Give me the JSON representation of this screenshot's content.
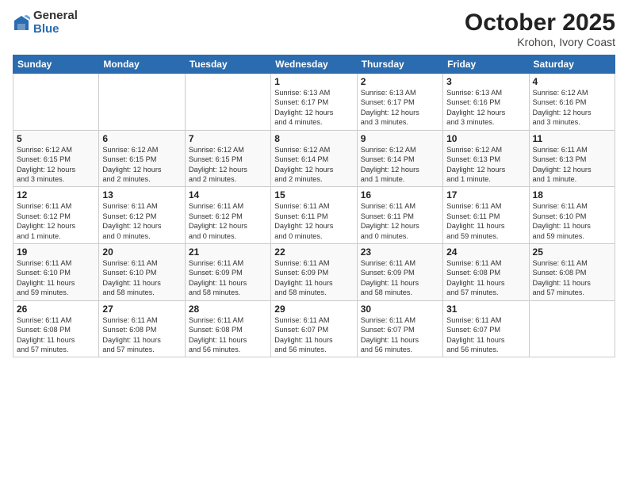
{
  "logo": {
    "general": "General",
    "blue": "Blue"
  },
  "header": {
    "month": "October 2025",
    "location": "Krohon, Ivory Coast"
  },
  "weekdays": [
    "Sunday",
    "Monday",
    "Tuesday",
    "Wednesday",
    "Thursday",
    "Friday",
    "Saturday"
  ],
  "weeks": [
    [
      {
        "day": "",
        "info": ""
      },
      {
        "day": "",
        "info": ""
      },
      {
        "day": "",
        "info": ""
      },
      {
        "day": "1",
        "info": "Sunrise: 6:13 AM\nSunset: 6:17 PM\nDaylight: 12 hours\nand 4 minutes."
      },
      {
        "day": "2",
        "info": "Sunrise: 6:13 AM\nSunset: 6:17 PM\nDaylight: 12 hours\nand 3 minutes."
      },
      {
        "day": "3",
        "info": "Sunrise: 6:13 AM\nSunset: 6:16 PM\nDaylight: 12 hours\nand 3 minutes."
      },
      {
        "day": "4",
        "info": "Sunrise: 6:12 AM\nSunset: 6:16 PM\nDaylight: 12 hours\nand 3 minutes."
      }
    ],
    [
      {
        "day": "5",
        "info": "Sunrise: 6:12 AM\nSunset: 6:15 PM\nDaylight: 12 hours\nand 3 minutes."
      },
      {
        "day": "6",
        "info": "Sunrise: 6:12 AM\nSunset: 6:15 PM\nDaylight: 12 hours\nand 2 minutes."
      },
      {
        "day": "7",
        "info": "Sunrise: 6:12 AM\nSunset: 6:15 PM\nDaylight: 12 hours\nand 2 minutes."
      },
      {
        "day": "8",
        "info": "Sunrise: 6:12 AM\nSunset: 6:14 PM\nDaylight: 12 hours\nand 2 minutes."
      },
      {
        "day": "9",
        "info": "Sunrise: 6:12 AM\nSunset: 6:14 PM\nDaylight: 12 hours\nand 1 minute."
      },
      {
        "day": "10",
        "info": "Sunrise: 6:12 AM\nSunset: 6:13 PM\nDaylight: 12 hours\nand 1 minute."
      },
      {
        "day": "11",
        "info": "Sunrise: 6:11 AM\nSunset: 6:13 PM\nDaylight: 12 hours\nand 1 minute."
      }
    ],
    [
      {
        "day": "12",
        "info": "Sunrise: 6:11 AM\nSunset: 6:12 PM\nDaylight: 12 hours\nand 1 minute."
      },
      {
        "day": "13",
        "info": "Sunrise: 6:11 AM\nSunset: 6:12 PM\nDaylight: 12 hours\nand 0 minutes."
      },
      {
        "day": "14",
        "info": "Sunrise: 6:11 AM\nSunset: 6:12 PM\nDaylight: 12 hours\nand 0 minutes."
      },
      {
        "day": "15",
        "info": "Sunrise: 6:11 AM\nSunset: 6:11 PM\nDaylight: 12 hours\nand 0 minutes."
      },
      {
        "day": "16",
        "info": "Sunrise: 6:11 AM\nSunset: 6:11 PM\nDaylight: 12 hours\nand 0 minutes."
      },
      {
        "day": "17",
        "info": "Sunrise: 6:11 AM\nSunset: 6:11 PM\nDaylight: 11 hours\nand 59 minutes."
      },
      {
        "day": "18",
        "info": "Sunrise: 6:11 AM\nSunset: 6:10 PM\nDaylight: 11 hours\nand 59 minutes."
      }
    ],
    [
      {
        "day": "19",
        "info": "Sunrise: 6:11 AM\nSunset: 6:10 PM\nDaylight: 11 hours\nand 59 minutes."
      },
      {
        "day": "20",
        "info": "Sunrise: 6:11 AM\nSunset: 6:10 PM\nDaylight: 11 hours\nand 58 minutes."
      },
      {
        "day": "21",
        "info": "Sunrise: 6:11 AM\nSunset: 6:09 PM\nDaylight: 11 hours\nand 58 minutes."
      },
      {
        "day": "22",
        "info": "Sunrise: 6:11 AM\nSunset: 6:09 PM\nDaylight: 11 hours\nand 58 minutes."
      },
      {
        "day": "23",
        "info": "Sunrise: 6:11 AM\nSunset: 6:09 PM\nDaylight: 11 hours\nand 58 minutes."
      },
      {
        "day": "24",
        "info": "Sunrise: 6:11 AM\nSunset: 6:08 PM\nDaylight: 11 hours\nand 57 minutes."
      },
      {
        "day": "25",
        "info": "Sunrise: 6:11 AM\nSunset: 6:08 PM\nDaylight: 11 hours\nand 57 minutes."
      }
    ],
    [
      {
        "day": "26",
        "info": "Sunrise: 6:11 AM\nSunset: 6:08 PM\nDaylight: 11 hours\nand 57 minutes."
      },
      {
        "day": "27",
        "info": "Sunrise: 6:11 AM\nSunset: 6:08 PM\nDaylight: 11 hours\nand 57 minutes."
      },
      {
        "day": "28",
        "info": "Sunrise: 6:11 AM\nSunset: 6:08 PM\nDaylight: 11 hours\nand 56 minutes."
      },
      {
        "day": "29",
        "info": "Sunrise: 6:11 AM\nSunset: 6:07 PM\nDaylight: 11 hours\nand 56 minutes."
      },
      {
        "day": "30",
        "info": "Sunrise: 6:11 AM\nSunset: 6:07 PM\nDaylight: 11 hours\nand 56 minutes."
      },
      {
        "day": "31",
        "info": "Sunrise: 6:11 AM\nSunset: 6:07 PM\nDaylight: 11 hours\nand 56 minutes."
      },
      {
        "day": "",
        "info": ""
      }
    ]
  ]
}
